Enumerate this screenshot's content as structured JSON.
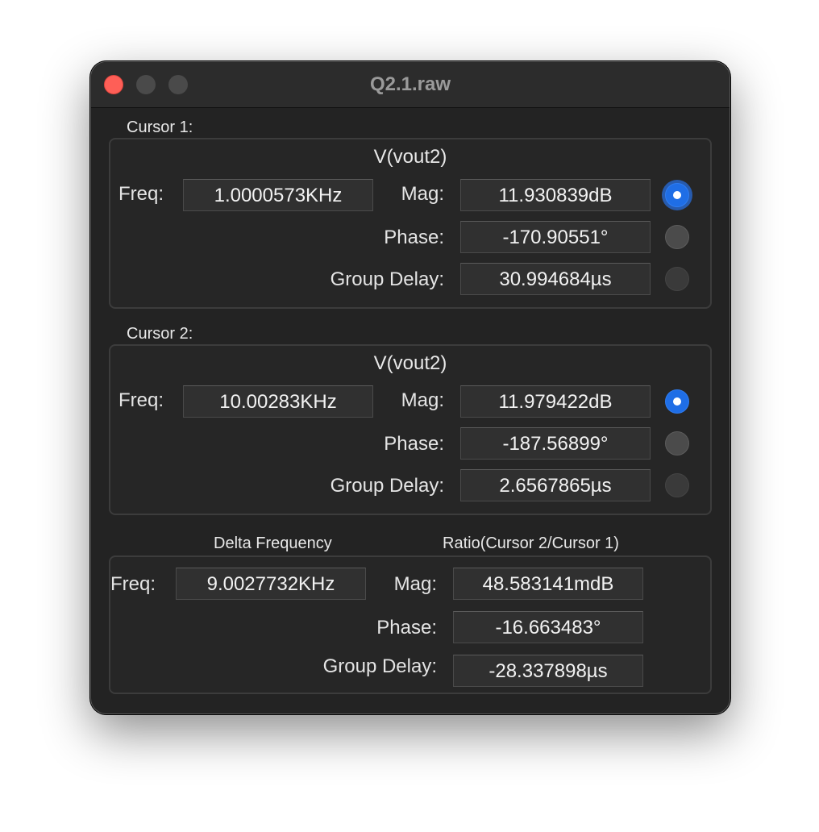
{
  "window": {
    "title": "Q2.1.raw"
  },
  "cursor1": {
    "caption": "Cursor 1:",
    "trace": "V(vout2)",
    "freq_label": "Freq:",
    "freq_value": "1.0000573KHz",
    "mag_label": "Mag:",
    "mag_value": "11.930839dB",
    "phase_label": "Phase:",
    "phase_value": "-170.90551°",
    "gd_label": "Group Delay:",
    "gd_value": "30.994684µs",
    "selected": "mag"
  },
  "cursor2": {
    "caption": "Cursor 2:",
    "trace": "V(vout2)",
    "freq_label": "Freq:",
    "freq_value": "10.00283KHz",
    "mag_label": "Mag:",
    "mag_value": "11.979422dB",
    "phase_label": "Phase:",
    "phase_value": "-187.56899°",
    "gd_label": "Group Delay:",
    "gd_value": "2.6567865µs",
    "selected": "mag"
  },
  "delta": {
    "freq_caption": "Delta Frequency",
    "ratio_caption": "Ratio(Cursor 2/Cursor 1)",
    "freq_label": "Freq:",
    "freq_value": "9.0027732KHz",
    "mag_label": "Mag:",
    "mag_value": "48.583141mdB",
    "phase_label": "Phase:",
    "phase_value": "-16.663483°",
    "gd_label": "Group Delay:",
    "gd_value": "-28.337898µs"
  },
  "colors": {
    "accent": "#1f6ee6",
    "close": "#fe5f57",
    "window_bg": "#232323"
  }
}
